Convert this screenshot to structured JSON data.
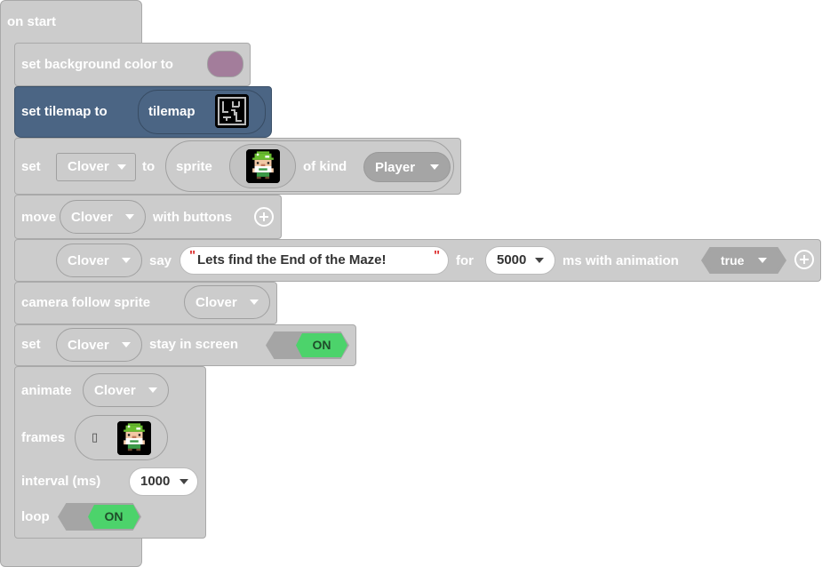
{
  "colors": {
    "block_gray": "#cccccc",
    "tilemap_block": "#4b6584",
    "background_swatch": "#a37d9b",
    "toggle_on": "#4cd36b"
  },
  "on_start": {
    "label": "on start"
  },
  "set_bg": {
    "label": "set background color to"
  },
  "set_tilemap": {
    "label": "set tilemap to",
    "value": "tilemap",
    "icon": "tilemap-maze-icon"
  },
  "set_sprite": {
    "label": "set",
    "var": "Clover",
    "to": "to",
    "sprite_label": "sprite",
    "of_kind": "of kind",
    "kind": "Player",
    "icon": "sprite-image-icon"
  },
  "move": {
    "label": "move",
    "var": "Clover",
    "with_buttons": "with buttons"
  },
  "say": {
    "var": "Clover",
    "say": "say",
    "text": "Lets find the End of the Maze!",
    "for": "for",
    "ms": "5000",
    "ms_anim": "ms with animation",
    "anim_value": "true"
  },
  "camera": {
    "label": "camera follow sprite",
    "var": "Clover"
  },
  "stay": {
    "label": "set",
    "var": "Clover",
    "stay": "stay in screen",
    "toggle": "ON"
  },
  "animate": {
    "label": "animate",
    "var": "Clover",
    "frames": "frames",
    "interval_label": "interval (ms)",
    "interval": "1000",
    "loop": "loop",
    "toggle": "ON"
  }
}
